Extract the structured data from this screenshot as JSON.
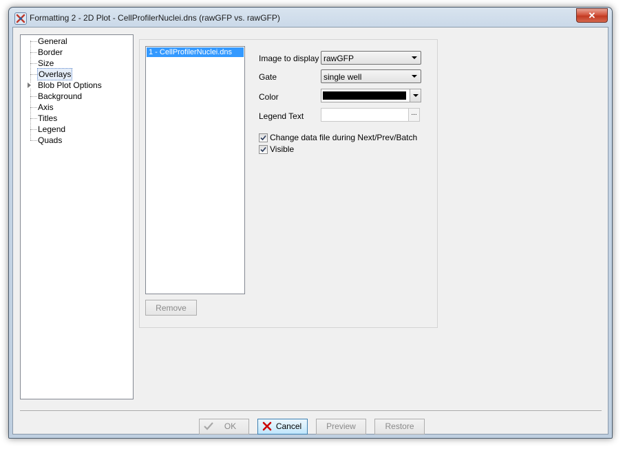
{
  "window": {
    "title": "Formatting 2 - 2D Plot - CellProfilerNuclei.dns (rawGFP vs. rawGFP)",
    "close_label": "✕"
  },
  "tree": {
    "items": [
      {
        "label": "General"
      },
      {
        "label": "Border"
      },
      {
        "label": "Size"
      },
      {
        "label": "Overlays",
        "selected": true
      },
      {
        "label": "Blob Plot Options",
        "expandable": true
      },
      {
        "label": "Background"
      },
      {
        "label": "Axis"
      },
      {
        "label": "Titles"
      },
      {
        "label": "Legend"
      },
      {
        "label": "Quads"
      }
    ]
  },
  "overlays": {
    "items": [
      "1 - CellProfilerNuclei.dns"
    ],
    "remove_label": "Remove"
  },
  "form": {
    "image_label": "Image to display",
    "image_value": "rawGFP",
    "gate_label": "Gate",
    "gate_value": "single well",
    "color_label": "Color",
    "color_value": "#000000",
    "legend_label": "Legend Text",
    "legend_value": "",
    "legend_button": "...",
    "change_data_label": "Change data file during Next/Prev/Batch",
    "change_data_checked": true,
    "visible_label": "Visible",
    "visible_checked": true
  },
  "buttons": {
    "ok": "OK",
    "cancel": "Cancel",
    "preview": "Preview",
    "restore": "Restore"
  },
  "icons": {
    "app": "x-app-icon",
    "ok": "checkmark-icon",
    "cancel": "red-x-icon"
  },
  "colors": {
    "selection": "#3399ff",
    "cancel_icon": "#cc0000"
  }
}
